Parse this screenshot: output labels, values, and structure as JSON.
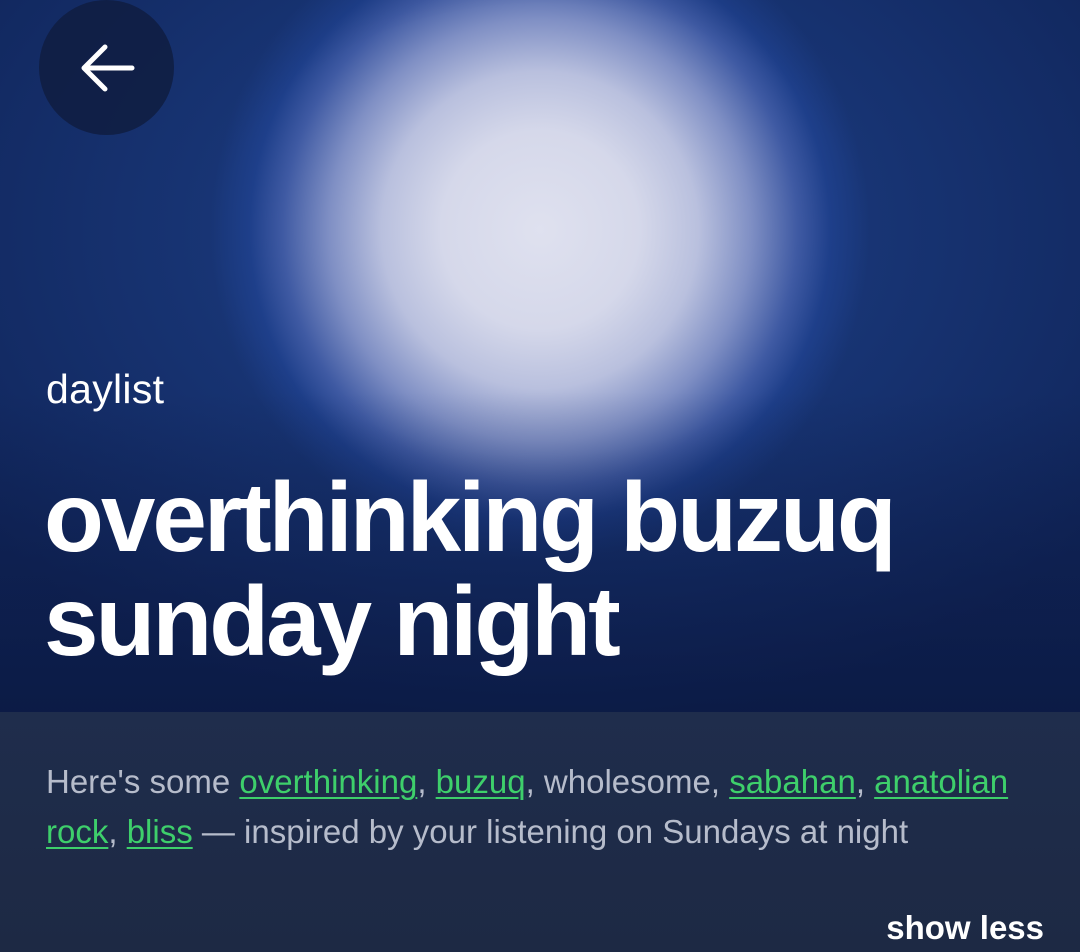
{
  "header": {
    "back_icon": "arrow-left-icon"
  },
  "playlist": {
    "type_label": "daylist",
    "title": "overthinking buzuq sunday night"
  },
  "description": {
    "intro": "Here's some ",
    "tags": [
      {
        "text": "overthinking",
        "link": true
      },
      {
        "text": "buzuq",
        "link": true
      },
      {
        "text": "wholesome",
        "link": false
      },
      {
        "text": "sabahan",
        "link": true
      },
      {
        "text": "anatolian rock",
        "link": true
      },
      {
        "text": "bliss",
        "link": true
      }
    ],
    "sep": ", ",
    "outro": " — inspired by your listening on Sundays at night"
  },
  "actions": {
    "show_less_label": "show less"
  },
  "colors": {
    "link_green": "#3ecf6b",
    "panel_bg": "#1f2d4c",
    "text_muted": "#b6bccb"
  }
}
